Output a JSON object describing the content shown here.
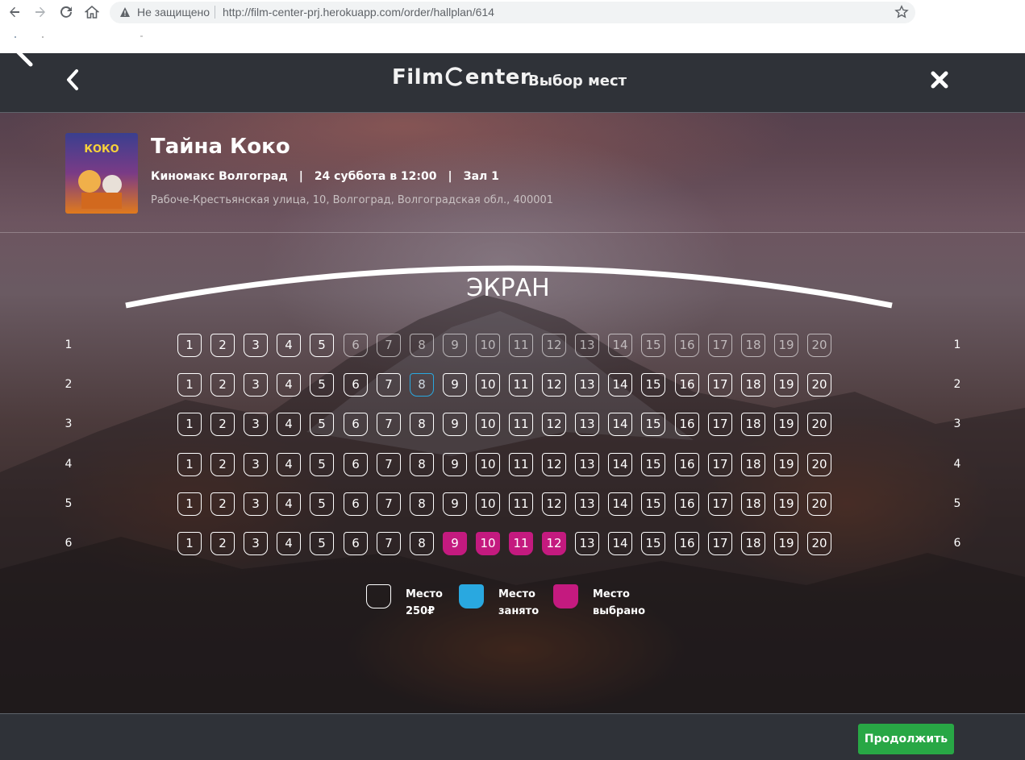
{
  "browser": {
    "status_text": "Не защищено",
    "url": "http://film-center-prj.herokuapp.com/order/hallplan/614"
  },
  "header": {
    "logo_part1": "Film",
    "logo_part2": "enter",
    "title": "Выбор мест"
  },
  "movie": {
    "title": "Тайна Коко",
    "cinema": "Киномакс Волгоград",
    "session": "24 суббота в 12:00",
    "hall": "Зал 1",
    "separator": "|",
    "address": "Рабоче-Крестьянская улица, 10, Волгоград, Волгоградская обл., 400001",
    "poster_text": "КОКО"
  },
  "hall": {
    "screen_label": "ЭКРАН",
    "rows": [
      {
        "label": "1",
        "seats": [
          {
            "n": "1",
            "state": "free"
          },
          {
            "n": "2",
            "state": "free"
          },
          {
            "n": "3",
            "state": "free"
          },
          {
            "n": "4",
            "state": "free"
          },
          {
            "n": "5",
            "state": "free"
          },
          {
            "n": "6",
            "state": "free"
          },
          {
            "n": "7",
            "state": "free"
          },
          {
            "n": "8",
            "state": "free"
          },
          {
            "n": "9",
            "state": "free"
          },
          {
            "n": "10",
            "state": "free"
          },
          {
            "n": "11",
            "state": "free"
          },
          {
            "n": "12",
            "state": "free"
          },
          {
            "n": "13",
            "state": "free"
          },
          {
            "n": "14",
            "state": "free"
          },
          {
            "n": "15",
            "state": "free"
          },
          {
            "n": "16",
            "state": "free"
          },
          {
            "n": "17",
            "state": "free"
          },
          {
            "n": "18",
            "state": "free"
          },
          {
            "n": "19",
            "state": "free"
          },
          {
            "n": "20",
            "state": "free"
          }
        ]
      },
      {
        "label": "2",
        "seats": [
          {
            "n": "1",
            "state": "free"
          },
          {
            "n": "2",
            "state": "free"
          },
          {
            "n": "3",
            "state": "free"
          },
          {
            "n": "4",
            "state": "free"
          },
          {
            "n": "5",
            "state": "free"
          },
          {
            "n": "6",
            "state": "free"
          },
          {
            "n": "7",
            "state": "free"
          },
          {
            "n": "8",
            "state": "hover"
          },
          {
            "n": "9",
            "state": "free"
          },
          {
            "n": "10",
            "state": "free"
          },
          {
            "n": "11",
            "state": "free"
          },
          {
            "n": "12",
            "state": "free"
          },
          {
            "n": "13",
            "state": "free"
          },
          {
            "n": "14",
            "state": "free"
          },
          {
            "n": "15",
            "state": "free"
          },
          {
            "n": "16",
            "state": "free"
          },
          {
            "n": "17",
            "state": "free"
          },
          {
            "n": "18",
            "state": "free"
          },
          {
            "n": "19",
            "state": "free"
          },
          {
            "n": "20",
            "state": "free"
          }
        ]
      },
      {
        "label": "3",
        "seats": [
          {
            "n": "1",
            "state": "free"
          },
          {
            "n": "2",
            "state": "free"
          },
          {
            "n": "3",
            "state": "free"
          },
          {
            "n": "4",
            "state": "free"
          },
          {
            "n": "5",
            "state": "free"
          },
          {
            "n": "6",
            "state": "free"
          },
          {
            "n": "7",
            "state": "free"
          },
          {
            "n": "8",
            "state": "free"
          },
          {
            "n": "9",
            "state": "free"
          },
          {
            "n": "10",
            "state": "free"
          },
          {
            "n": "11",
            "state": "free"
          },
          {
            "n": "12",
            "state": "free"
          },
          {
            "n": "13",
            "state": "free"
          },
          {
            "n": "14",
            "state": "free"
          },
          {
            "n": "15",
            "state": "free"
          },
          {
            "n": "16",
            "state": "free"
          },
          {
            "n": "17",
            "state": "free"
          },
          {
            "n": "18",
            "state": "free"
          },
          {
            "n": "19",
            "state": "free"
          },
          {
            "n": "20",
            "state": "free"
          }
        ]
      },
      {
        "label": "4",
        "seats": [
          {
            "n": "1",
            "state": "free"
          },
          {
            "n": "2",
            "state": "free"
          },
          {
            "n": "3",
            "state": "free"
          },
          {
            "n": "4",
            "state": "free"
          },
          {
            "n": "5",
            "state": "free"
          },
          {
            "n": "6",
            "state": "free"
          },
          {
            "n": "7",
            "state": "free"
          },
          {
            "n": "8",
            "state": "free"
          },
          {
            "n": "9",
            "state": "free"
          },
          {
            "n": "10",
            "state": "free"
          },
          {
            "n": "11",
            "state": "free"
          },
          {
            "n": "12",
            "state": "free"
          },
          {
            "n": "13",
            "state": "free"
          },
          {
            "n": "14",
            "state": "free"
          },
          {
            "n": "15",
            "state": "free"
          },
          {
            "n": "16",
            "state": "free"
          },
          {
            "n": "17",
            "state": "free"
          },
          {
            "n": "18",
            "state": "free"
          },
          {
            "n": "19",
            "state": "free"
          },
          {
            "n": "20",
            "state": "free"
          }
        ]
      },
      {
        "label": "5",
        "seats": [
          {
            "n": "1",
            "state": "free"
          },
          {
            "n": "2",
            "state": "free"
          },
          {
            "n": "3",
            "state": "free"
          },
          {
            "n": "4",
            "state": "free"
          },
          {
            "n": "5",
            "state": "free"
          },
          {
            "n": "6",
            "state": "free"
          },
          {
            "n": "7",
            "state": "free"
          },
          {
            "n": "8",
            "state": "free"
          },
          {
            "n": "9",
            "state": "free"
          },
          {
            "n": "10",
            "state": "free"
          },
          {
            "n": "11",
            "state": "free"
          },
          {
            "n": "12",
            "state": "free"
          },
          {
            "n": "13",
            "state": "free"
          },
          {
            "n": "14",
            "state": "free"
          },
          {
            "n": "15",
            "state": "free"
          },
          {
            "n": "16",
            "state": "free"
          },
          {
            "n": "17",
            "state": "free"
          },
          {
            "n": "18",
            "state": "free"
          },
          {
            "n": "19",
            "state": "free"
          },
          {
            "n": "20",
            "state": "free"
          }
        ]
      },
      {
        "label": "6",
        "seats": [
          {
            "n": "1",
            "state": "free"
          },
          {
            "n": "2",
            "state": "free"
          },
          {
            "n": "3",
            "state": "free"
          },
          {
            "n": "4",
            "state": "free"
          },
          {
            "n": "5",
            "state": "free"
          },
          {
            "n": "6",
            "state": "free"
          },
          {
            "n": "7",
            "state": "free"
          },
          {
            "n": "8",
            "state": "free"
          },
          {
            "n": "9",
            "state": "selected"
          },
          {
            "n": "10",
            "state": "selected"
          },
          {
            "n": "11",
            "state": "selected"
          },
          {
            "n": "12",
            "state": "selected"
          },
          {
            "n": "13",
            "state": "free"
          },
          {
            "n": "14",
            "state": "free"
          },
          {
            "n": "15",
            "state": "free"
          },
          {
            "n": "16",
            "state": "free"
          },
          {
            "n": "17",
            "state": "free"
          },
          {
            "n": "18",
            "state": "free"
          },
          {
            "n": "19",
            "state": "free"
          },
          {
            "n": "20",
            "state": "free"
          }
        ]
      }
    ]
  },
  "legend": {
    "free": {
      "line1": "Место",
      "line2": "250₽"
    },
    "taken": {
      "line1": "Место",
      "line2": "занято",
      "color": "#29a8e0"
    },
    "selected": {
      "line1": "Место",
      "line2": "выбрано",
      "color": "#c41a7f"
    }
  },
  "footer": {
    "continue_label": "Продолжить",
    "continue_color": "#28a745"
  }
}
